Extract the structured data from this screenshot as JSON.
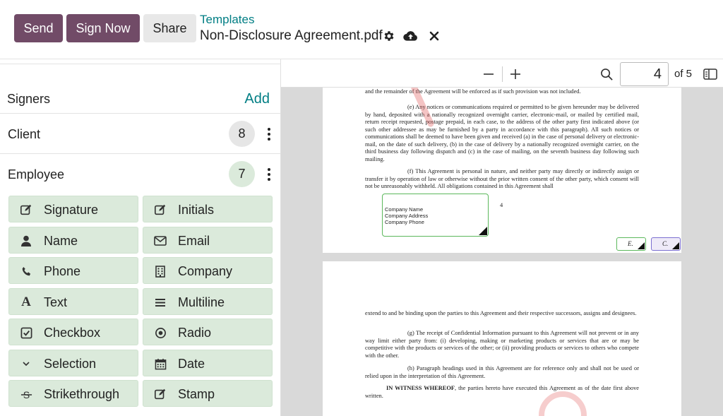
{
  "toolbar": {
    "send_label": "Send",
    "sign_now_label": "Sign Now",
    "share_label": "Share",
    "breadcrumb": "Templates",
    "document_title": "Non-Disclosure Agreement.pdf",
    "icons": [
      "gear-icon",
      "cloud-upload-icon",
      "close-icon"
    ],
    "primary_color": "#714b67",
    "link_color": "#017e84"
  },
  "signers_panel": {
    "title": "Signers",
    "add_label": "Add",
    "signers": [
      {
        "name": "Client",
        "count": "8",
        "badge_color": "#e6e6e6"
      },
      {
        "name": "Employee",
        "count": "7",
        "badge_color": "#dbeadb"
      }
    ],
    "fields": [
      {
        "label": "Signature",
        "icon": "pen-square-icon",
        "glyph": "✎"
      },
      {
        "label": "Initials",
        "icon": "pen-square-icon",
        "glyph": "✎"
      },
      {
        "label": "Name",
        "icon": "user-icon",
        "glyph": "●"
      },
      {
        "label": "Email",
        "icon": "envelope-icon",
        "glyph": "✉"
      },
      {
        "label": "Phone",
        "icon": "phone-icon",
        "glyph": "✆"
      },
      {
        "label": "Company",
        "icon": "building-icon",
        "glyph": "▦"
      },
      {
        "label": "Text",
        "icon": "text-font-icon",
        "glyph": "A"
      },
      {
        "label": "Multiline",
        "icon": "lines-icon",
        "glyph": "≡"
      },
      {
        "label": "Checkbox",
        "icon": "checkbox-checked-icon",
        "glyph": "☑"
      },
      {
        "label": "Radio",
        "icon": "radio-dot-icon",
        "glyph": "◉"
      },
      {
        "label": "Selection",
        "icon": "chevron-down-icon",
        "glyph": "⌄"
      },
      {
        "label": "Date",
        "icon": "calendar-icon",
        "glyph": "▦"
      },
      {
        "label": "Strikethrough",
        "icon": "strikethrough-icon",
        "glyph": "S"
      },
      {
        "label": "Stamp",
        "icon": "pen-square-icon",
        "glyph": "✎"
      }
    ]
  },
  "viewer": {
    "current_page": "4",
    "of_pages": "of 5",
    "page4": {
      "line_top": "and the remainder of the Agreement will be enforced as if such provision was not included.",
      "para_e": "(e)        Any notices or communications required or permitted to be given hereunder may be delivered by hand, deposited with a nationally recognized overnight carrier, electronic-mail, or mailed by certified mail, return receipt requested, postage prepaid, in each case, to the address of the other party first indicated above (or such other addressee as may be furnished by a party in accordance with this paragraph).  All such notices or communications shall be deemed to have been given and received (a) in the case of personal delivery or electronic-mail, on the date of such delivery, (b) in the case of delivery by a nationally recognized overnight carrier, on the third business day following dispatch and (c) in the case of mailing, on the seventh business day following such mailing.",
      "para_f": "(f)        This Agreement is personal in nature, and neither party may directly or indirectly assign or transfer it by operation of law or otherwise without the prior written consent of the other party, which consent will not be unreasonably withheld.  All obligations contained in this Agreement shall",
      "page_number": "4",
      "company_box": {
        "line1": "Company Name",
        "line2": "Company Address",
        "line3": "Company Phone"
      },
      "initial_client": "E.",
      "initial_employee": "C."
    },
    "page5": {
      "para_top": "extend to and be binding upon the parties to this Agreement and their respective successors, assigns and designees.",
      "para_g": "(g)        The receipt of Confidential Information pursuant to this Agreement will not prevent or in any way limit either party from: (i) developing, making or marketing products or services that are or may be competitive with the products or services of the other; or (ii) providing products or services to others who compete with the other.",
      "para_h": "(h)        Paragraph headings used in this Agreement are for reference only and shall not be used or relied upon in the interpretation of this Agreement.",
      "witness_bold": "IN WITNESS WHEREOF",
      "witness_rest": ", the parties hereto have executed this Agreement as of the date first above written."
    }
  }
}
